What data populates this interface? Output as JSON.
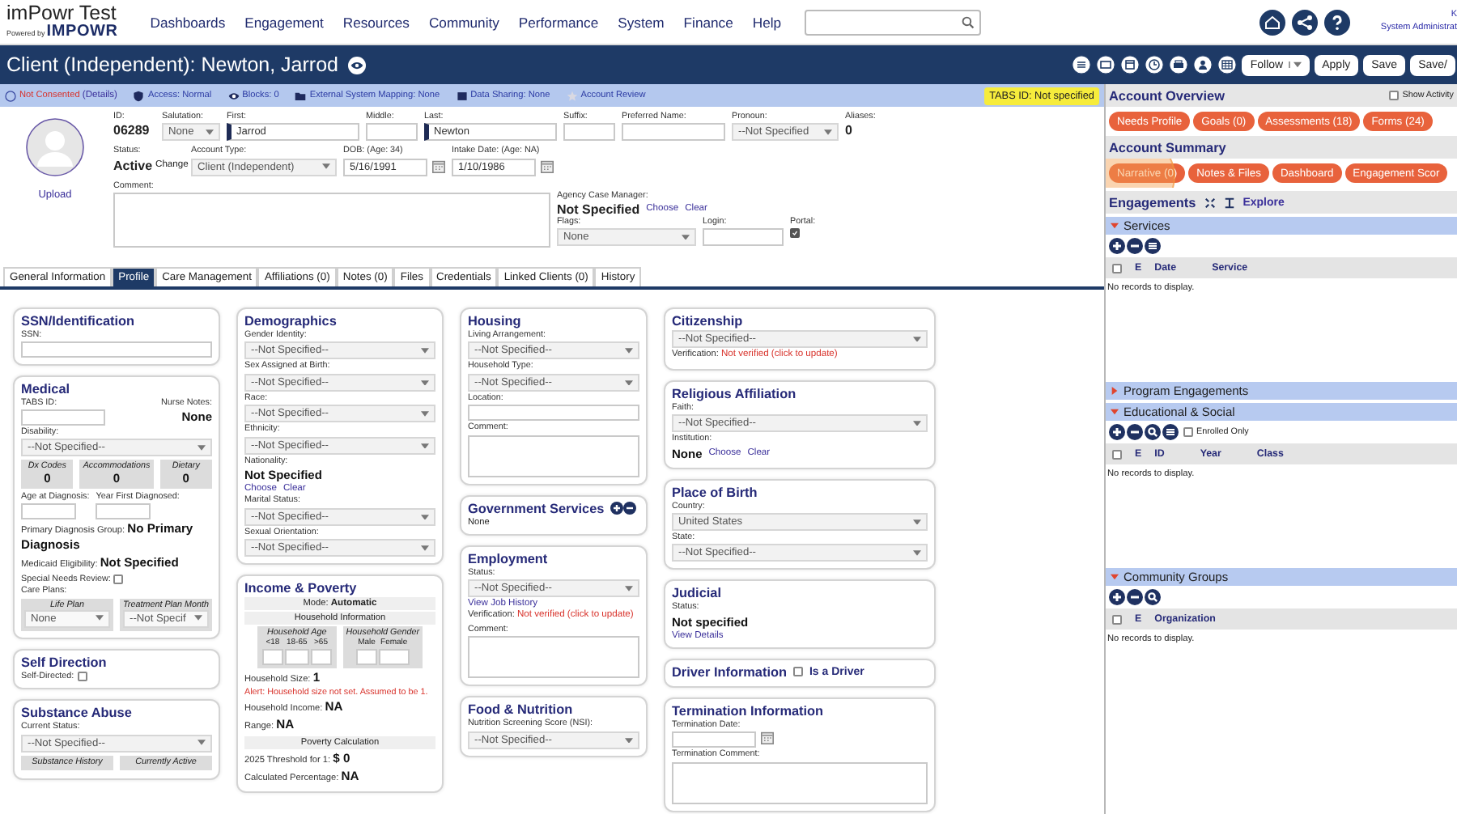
{
  "nav": {
    "brand": "imPowr Test",
    "powered_by": "Powered by",
    "logo": "IMPOWR",
    "menu": [
      "Dashboards",
      "Engagement",
      "Resources",
      "Community",
      "Performance",
      "System",
      "Finance",
      "Help"
    ],
    "user_name": "K",
    "user_role": "System Administrat"
  },
  "title_bar": {
    "title": "Client (Independent): Newton, Jarrod",
    "buttons": [
      {
        "label": "Follow",
        "kind": "dropdown"
      },
      {
        "label": "Apply",
        "kind": "plain"
      },
      {
        "label": "Save",
        "kind": "plain"
      },
      {
        "label": "Save/",
        "kind": "plain"
      }
    ]
  },
  "status_strip": {
    "items": [
      {
        "kind": "consent",
        "label": "Not Consented",
        "link": "(Details)"
      },
      {
        "kind": "shield",
        "label": "Access: Normal"
      },
      {
        "kind": "eye",
        "label": "Blocks: 0"
      },
      {
        "kind": "folder",
        "label": "External System Mapping: None"
      },
      {
        "kind": "book",
        "label": "Data Sharing: None"
      },
      {
        "kind": "star",
        "label": "Account Review"
      }
    ],
    "badge": "TABS ID: Not specified"
  },
  "header": {
    "upload": "Upload",
    "id": {
      "label": "ID:",
      "value": "06289"
    },
    "salutation": {
      "label": "Salutation:",
      "value": "None"
    },
    "first": {
      "label": "First:",
      "value": "Jarrod"
    },
    "middle": {
      "label": "Middle:"
    },
    "last": {
      "label": "Last:",
      "value": "Newton"
    },
    "suffix": {
      "label": "Suffix:"
    },
    "preferred_name": {
      "label": "Preferred Name:"
    },
    "pronoun": {
      "label": "Pronoun:",
      "value": "--Not Specified"
    },
    "aliases": {
      "label": "Aliases:",
      "value": "0"
    },
    "status": {
      "label": "Status:",
      "value": "Active",
      "action": "Change"
    },
    "account_type": {
      "label": "Account Type:",
      "value": "Client (Independent)"
    },
    "dob": {
      "label": "DOB: (Age: 34)",
      "value": "5/16/1991"
    },
    "intake_date": {
      "label": "Intake Date: (Age: NA)",
      "value": "1/10/1986"
    },
    "comment": {
      "label": "Comment:"
    },
    "case_manager": {
      "label": "Agency Case Manager:",
      "value": "Not Specified",
      "links": [
        "Choose",
        "Clear"
      ]
    },
    "flags": {
      "label": "Flags:",
      "value": "None"
    },
    "login": {
      "label": "Login:"
    },
    "portal": {
      "label": "Portal:",
      "checked": true
    }
  },
  "tabs": [
    {
      "label": "General Information",
      "selected": false
    },
    {
      "label": "Profile",
      "selected": true
    },
    {
      "label": "Care Management",
      "selected": false
    },
    {
      "label": "Affiliations (0)",
      "selected": false
    },
    {
      "label": "Notes (0)",
      "selected": false
    },
    {
      "label": "Files",
      "selected": false
    },
    {
      "label": "Credentials",
      "selected": false
    },
    {
      "label": "Linked Clients (0)",
      "selected": false
    },
    {
      "label": "History",
      "selected": false
    }
  ],
  "profile_columns": [
    [
      {
        "title": "SSN/Identification",
        "fields": [
          {
            "kind": "input",
            "label": "SSN:"
          }
        ]
      },
      {
        "title": "Medical",
        "fields": [
          {
            "kind": "input_note",
            "label": "TABS ID:",
            "note_label": "Nurse Notes:",
            "note_value": "None"
          },
          {
            "kind": "select",
            "label": "Disability:",
            "value": "--Not Specified--"
          },
          {
            "kind": "stats",
            "items": [
              {
                "label": "Dx Codes",
                "value": "0"
              },
              {
                "label": "Accommodations",
                "value": "0"
              },
              {
                "label": "Dietary",
                "value": "0"
              }
            ]
          },
          {
            "kind": "inputs",
            "labels": [
              "Age at Diagnosis:",
              "Year First Diagnosed:"
            ]
          },
          {
            "kind": "text",
            "label": "Primary Diagnosis Group:",
            "value": "No Primary Diagnosis"
          },
          {
            "kind": "text",
            "label": "Medicaid Eligibility:",
            "value": "Not Specified"
          },
          {
            "kind": "check",
            "label": "Special Needs Review:",
            "checked": false
          },
          {
            "kind": "plans",
            "label": "Care Plans:",
            "items": [
              {
                "label": "Life Plan",
                "value": "None"
              },
              {
                "label": "Treatment Plan Month",
                "value": "--Not Specif"
              }
            ]
          }
        ]
      },
      {
        "title": "Self Direction",
        "fields": [
          {
            "kind": "check",
            "label": "Self-Directed:",
            "checked": false
          }
        ]
      },
      {
        "title": "Substance Abuse",
        "fields": [
          {
            "kind": "select",
            "label": "Current Status:",
            "value": "--Not Specified--"
          },
          {
            "kind": "stats",
            "items": [
              {
                "label": "Substance History"
              },
              {
                "label": "Currently Active"
              }
            ]
          }
        ]
      }
    ],
    [
      {
        "title": "Demographics",
        "fields": [
          {
            "kind": "select",
            "label": "Gender Identity:",
            "value": "--Not Specified--"
          },
          {
            "kind": "select",
            "label": "Sex Assigned at Birth:",
            "value": "--Not Specified--"
          },
          {
            "kind": "select",
            "label": "Race:",
            "value": "--Not Specified--"
          },
          {
            "kind": "select",
            "label": "Ethnicity:",
            "value": "--Not Specified--"
          },
          {
            "kind": "label",
            "label": "Nationality:"
          },
          {
            "kind": "bold",
            "value": "Not Specified"
          },
          {
            "kind": "links",
            "items": [
              "Choose",
              "Clear"
            ]
          },
          {
            "kind": "select",
            "label": "Marital Status:",
            "value": "--Not Specified--"
          },
          {
            "kind": "select",
            "label": "Sexual Orientation:",
            "value": "--Not Specified--"
          }
        ]
      },
      {
        "title": "Income & Poverty",
        "fields": [
          {
            "kind": "band",
            "label": "Mode:",
            "value": "Automatic"
          },
          {
            "kind": "band",
            "label": "Household Information"
          },
          {
            "kind": "household",
            "groups": [
              {
                "label": "Household Age",
                "cols": [
                  "<18",
                  "18-65",
                  ">65"
                ]
              },
              {
                "label": "Household Gender",
                "cols": [
                  "Male",
                  "Female"
                ]
              }
            ]
          },
          {
            "kind": "text",
            "label": "Household Size:",
            "value": "1"
          },
          {
            "kind": "alert",
            "value": "Alert: Household size not set. Assumed to be 1."
          },
          {
            "kind": "text",
            "label": "Household Income:",
            "value": "NA"
          },
          {
            "kind": "text",
            "label": "Range:",
            "value": "NA"
          },
          {
            "kind": "band",
            "label": "Poverty Calculation"
          },
          {
            "kind": "text",
            "label": "2025 Threshold for 1:",
            "value": "$ 0"
          },
          {
            "kind": "text",
            "label": "Calculated Percentage:",
            "value": "NA"
          }
        ]
      }
    ],
    [
      {
        "title": "Housing",
        "fields": [
          {
            "kind": "select",
            "label": "Living Arrangement:",
            "value": "--Not Specified--"
          },
          {
            "kind": "select",
            "label": "Household Type:",
            "value": "--Not Specified--"
          },
          {
            "kind": "input",
            "label": "Location:"
          },
          {
            "kind": "textarea",
            "label": "Comment:"
          }
        ]
      },
      {
        "title": "Government Services",
        "actions": true,
        "fields": [
          {
            "kind": "plain",
            "value": "None"
          }
        ]
      },
      {
        "title": "Employment",
        "fields": [
          {
            "kind": "select",
            "label": "Status:",
            "value": "--Not Specified--"
          },
          {
            "kind": "links",
            "items": [
              "View Job History"
            ]
          },
          {
            "kind": "verify",
            "label": "Verification:",
            "value": "Not verified (click to update)"
          },
          {
            "kind": "textarea",
            "label": "Comment:"
          }
        ]
      },
      {
        "title": "Food & Nutrition",
        "fields": [
          {
            "kind": "select",
            "label": "Nutrition Screening Score (NSI):",
            "value": "--Not Specified--"
          }
        ]
      }
    ],
    [
      {
        "title": "Citizenship",
        "fields": [
          {
            "kind": "select",
            "value": "--Not Specified--"
          },
          {
            "kind": "verify",
            "label": "Verification:",
            "value": "Not verified (click to update)"
          }
        ]
      },
      {
        "title": "Religious Affiliation",
        "fields": [
          {
            "kind": "select",
            "label": "Faith:",
            "value": "--Not Specified--"
          },
          {
            "kind": "label",
            "label": "Institution:"
          },
          {
            "kind": "bold_links",
            "value": "None",
            "items": [
              "Choose",
              "Clear"
            ]
          }
        ]
      },
      {
        "title": "Place of Birth",
        "fields": [
          {
            "kind": "select",
            "label": "Country:",
            "value": "United States"
          },
          {
            "kind": "select",
            "label": "State:",
            "value": "--Not Specified--"
          }
        ]
      },
      {
        "title": "Judicial",
        "fields": [
          {
            "kind": "label",
            "label": "Status:"
          },
          {
            "kind": "bold",
            "value": "Not specified"
          },
          {
            "kind": "links",
            "items": [
              "View Details"
            ]
          }
        ]
      },
      {
        "title": "Driver Information",
        "title_check": {
          "label": "Is a Driver",
          "checked": false
        }
      },
      {
        "title": "Termination Information",
        "fields": [
          {
            "kind": "date",
            "label": "Termination Date:"
          },
          {
            "kind": "textarea",
            "label": "Termination Comment:"
          }
        ]
      }
    ]
  ],
  "panel": {
    "overview": {
      "title": "Account Overview",
      "show_activity": {
        "label": "Show Activity",
        "checked": false
      },
      "buttons": [
        "Needs Profile",
        "Goals (0)",
        "Assessments (18)",
        "Forms (24)"
      ]
    },
    "summary": {
      "title": "Account Summary",
      "buttons": [
        {
          "label": "Narrative (0)",
          "highlighted": true
        },
        {
          "label": "Notes & Files",
          "highlighted": false
        },
        {
          "label": "Dashboard",
          "highlighted": false
        },
        {
          "label": "Engagement Scor",
          "highlighted": false
        }
      ]
    },
    "engagements": {
      "title": "Engagements",
      "link": "Explore"
    },
    "sections": [
      {
        "title": "Services",
        "expanded": true,
        "all_checked": false,
        "columns": [
          "E",
          "Date",
          "Service"
        ],
        "empty": "No records to display."
      },
      {
        "title": "Program Engagements",
        "expanded": false
      },
      {
        "title": "Educational & Social",
        "expanded": true,
        "all_checked": false,
        "filter": {
          "label": "Enrolled Only",
          "checked": false
        },
        "columns": [
          "E",
          "ID",
          "Year",
          "Class"
        ],
        "empty": "No records to display."
      },
      {
        "title": "Community Groups",
        "expanded": true,
        "all_checked": false,
        "columns": [
          "E",
          "Organization"
        ],
        "empty": "No records to display."
      }
    ]
  }
}
